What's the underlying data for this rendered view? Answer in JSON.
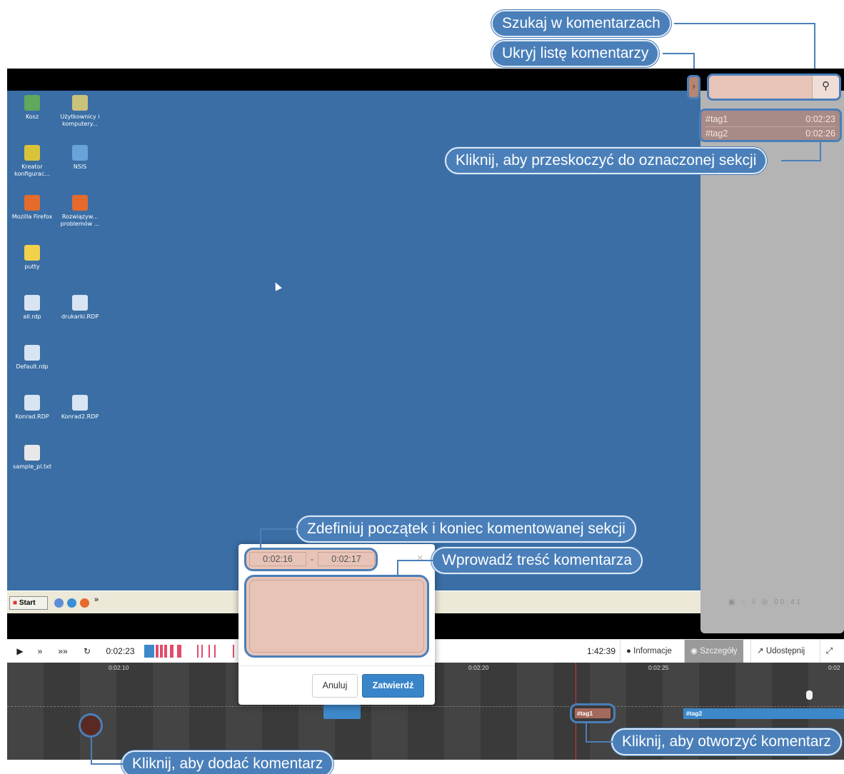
{
  "callouts": {
    "search_comments": "Szukaj w komentarzach",
    "hide_comment_list": "Ukryj listę komentarzy",
    "jump_to_section": "Kliknij, aby przeskoczyć do oznaczonej sekcji",
    "define_range": "Zdefiniuj początek i koniec komentowanej sekcji",
    "enter_comment": "Wprowadź treść komentarza",
    "open_comment": "Kliknij, aby otworzyć komentarz",
    "add_comment": "Kliknij, aby dodać komentarz"
  },
  "desktop": {
    "background": "#3a6ea5",
    "icons": [
      {
        "label": "Kosz",
        "icon": "recycle-bin-icon",
        "color": "#5fa85c"
      },
      {
        "label": "Użytkownicy i komputery...",
        "icon": "users-computers-icon",
        "color": "#c9c27a"
      },
      {
        "label": "Kreator konfigurac...",
        "icon": "wizard-icon",
        "color": "#d9c33a"
      },
      {
        "label": "NSIS",
        "icon": "nsis-icon",
        "color": "#6aa3d9"
      },
      {
        "label": "Mozilla Firefox",
        "icon": "firefox-icon",
        "color": "#e66a2c"
      },
      {
        "label": "Rozwiązyw... problemów ...",
        "icon": "troubleshoot-icon",
        "color": "#e66a2c"
      },
      {
        "label": "putty",
        "icon": "folder-icon",
        "color": "#f2d24b"
      },
      {
        "label": "all.rdp",
        "icon": "rdp-icon",
        "color": "#d8e4f2"
      },
      {
        "label": "drukarki.RDP",
        "icon": "rdp-icon",
        "color": "#d8e4f2"
      },
      {
        "label": "Default.rdp",
        "icon": "rdp-icon",
        "color": "#d8e4f2"
      },
      {
        "label": "Konrad.RDP",
        "icon": "rdp-icon",
        "color": "#d8e4f2"
      },
      {
        "label": "Konrad2.RDP",
        "icon": "rdp-icon",
        "color": "#d8e4f2"
      },
      {
        "label": "sample_pl.txt",
        "icon": "text-file-icon",
        "color": "#e8e8e8"
      }
    ],
    "start_label": "Start",
    "tray_time": "00:41"
  },
  "sidebar": {
    "search_placeholder": "",
    "search_icon": "search-icon",
    "collapse_icon": "chevron-right-icon",
    "tags": [
      {
        "name": "#tag1",
        "time": "0:02:23"
      },
      {
        "name": "#tag2",
        "time": "0:02:26"
      }
    ]
  },
  "controls": {
    "play": "▶",
    "step": "»",
    "fast": "»»",
    "replay": "↻",
    "current_time": "0:02:23",
    "total_time": "1:42:39",
    "tabs": {
      "info": "Informacje",
      "details": "Szczegóły",
      "share": "Udostępnij"
    },
    "fullscreen_icon": "expand-icon"
  },
  "timeline": {
    "ticks": [
      "0:02:10",
      "0:02:20",
      "0:02:25",
      "0:02"
    ],
    "tag1_label": "#tag1",
    "tag2_label": "#tag2"
  },
  "dialog": {
    "start_time": "0:02:16",
    "range_separator": "-",
    "end_time": "0:02:17",
    "close": "×",
    "comment_value": "",
    "cancel": "Anuluj",
    "confirm": "Zatwierdź"
  },
  "colors": {
    "callout": "#4a7fb9",
    "highlight": "#e8c4b8",
    "accent_blue": "#3d88c9"
  }
}
